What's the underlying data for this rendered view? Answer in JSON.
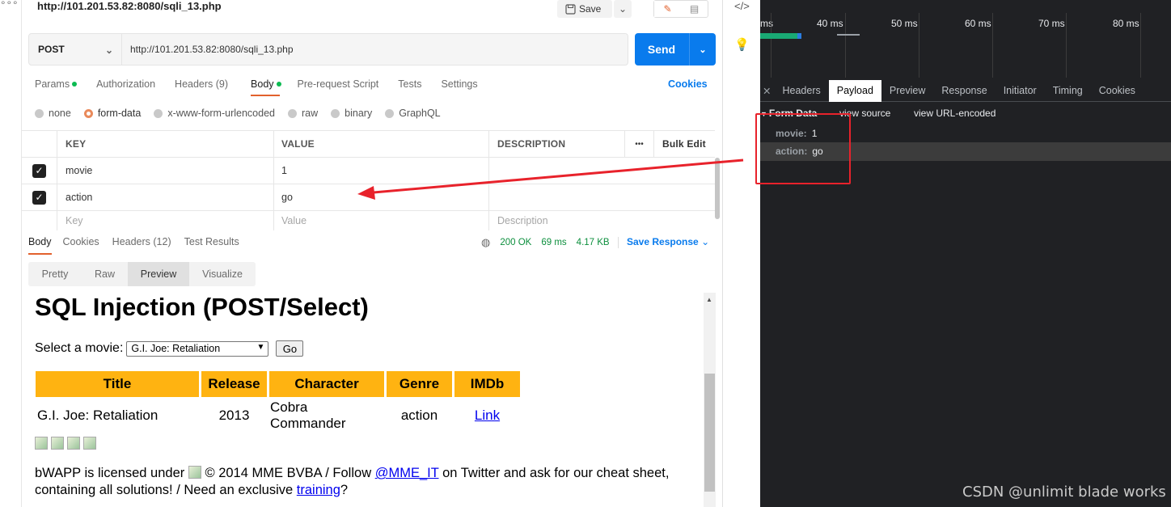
{
  "postman": {
    "request_title": "http://101.201.53.82:8080/sqli_13.php",
    "save_label": "Save",
    "method": "POST",
    "url": "http://101.201.53.82:8080/sqli_13.php",
    "send_label": "Send",
    "req_tabs": [
      "Params",
      "Authorization",
      "Headers (9)",
      "Body",
      "Pre-request Script",
      "Tests",
      "Settings"
    ],
    "cookies_label": "Cookies",
    "body_types": [
      "none",
      "form-data",
      "x-www-form-urlencoded",
      "raw",
      "binary",
      "GraphQL"
    ],
    "selected_body_type": "form-data",
    "table": {
      "headers": [
        "KEY",
        "VALUE",
        "DESCRIPTION"
      ],
      "more_label": "•••",
      "bulk_edit_label": "Bulk Edit",
      "rows": [
        {
          "key": "movie",
          "value": "1",
          "checked": true
        },
        {
          "key": "action",
          "value": "go",
          "checked": true
        }
      ],
      "placeholders": {
        "key": "Key",
        "value": "Value",
        "description": "Description"
      }
    },
    "resp_tabs": [
      "Body",
      "Cookies",
      "Headers (12)",
      "Test Results"
    ],
    "status": "200 OK",
    "time": "69 ms",
    "size": "4.17 KB",
    "save_response_label": "Save Response",
    "view_tabs": [
      "Pretty",
      "Raw",
      "Preview",
      "Visualize"
    ],
    "active_view": "Preview"
  },
  "preview": {
    "heading": "SQL Injection (POST/Select)",
    "select_label": "Select a movie:",
    "selected_movie": "G.I. Joe: Retaliation",
    "go_label": "Go",
    "columns": [
      "Title",
      "Release",
      "Character",
      "Genre",
      "IMDb"
    ],
    "row": {
      "title": "G.I. Joe: Retaliation",
      "release": "2013",
      "character": "Cobra Commander",
      "genre": "action",
      "imdb": "Link"
    },
    "footer_a": "bWAPP is licensed under",
    "footer_b": "© 2014 MME BVBA / Follow",
    "footer_handle": "@MME_IT",
    "footer_c": "on Twitter and ask for our cheat sheet, containing all solutions! / Need an exclusive",
    "footer_training": "training",
    "footer_q": "?"
  },
  "devtools": {
    "ticks": [
      "40 ms",
      "50 ms",
      "60 ms",
      "70 ms",
      "80 ms"
    ],
    "tabs": [
      "Headers",
      "Payload",
      "Preview",
      "Response",
      "Initiator",
      "Timing",
      "Cookies"
    ],
    "active_tab": "Payload",
    "form_data_label": "Form Data",
    "view_source": "view source",
    "view_url_encoded": "view URL-encoded",
    "payload": [
      {
        "name": "movie:",
        "value": "1"
      },
      {
        "name": "action:",
        "value": "go"
      }
    ]
  },
  "watermark": "CSDN @unlimit blade works",
  "colors": {
    "accent": "#e2612d",
    "send": "#097bed",
    "table_header": "#ffb311",
    "annotation": "#e8222b"
  }
}
